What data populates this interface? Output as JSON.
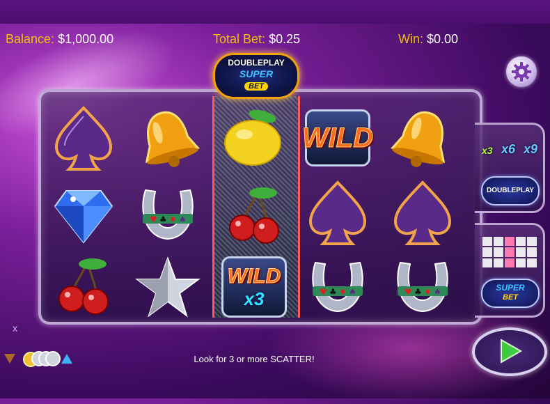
{
  "hud": {
    "balance_label": "Balance:",
    "balance_value": "$1,000.00",
    "total_bet_label": "Total Bet:",
    "total_bet_value": "$0.25",
    "win_label": "Win:",
    "win_value": "$0.00"
  },
  "logo": {
    "line1": "DOUBLEPLAY",
    "line2": "SUPER",
    "line3": "BET"
  },
  "reels": [
    [
      "spade",
      "diamond",
      "cherry"
    ],
    [
      "bell",
      "horseshoe",
      "star"
    ],
    [
      "lemon",
      "cherry",
      "wild-x3"
    ],
    [
      "wild",
      "spade",
      "horseshoe"
    ],
    [
      "bell",
      "spade",
      "horseshoe"
    ]
  ],
  "symbols": {
    "wild_text": "WILD",
    "wild_multiplier": "x3"
  },
  "side_panel": {
    "multipliers": [
      "x3",
      "x6",
      "x9"
    ],
    "doubleplay_label": "DOUBLEPLAY",
    "superbet_line1": "SUPER",
    "superbet_line2": "BET"
  },
  "message": "Look for 3 or more SCATTER!",
  "close_symbol": "x",
  "colors": {
    "accent_gold": "#f5c000",
    "reel_highlight": "#7be38c",
    "wild_orange": "#ff6b1a"
  }
}
